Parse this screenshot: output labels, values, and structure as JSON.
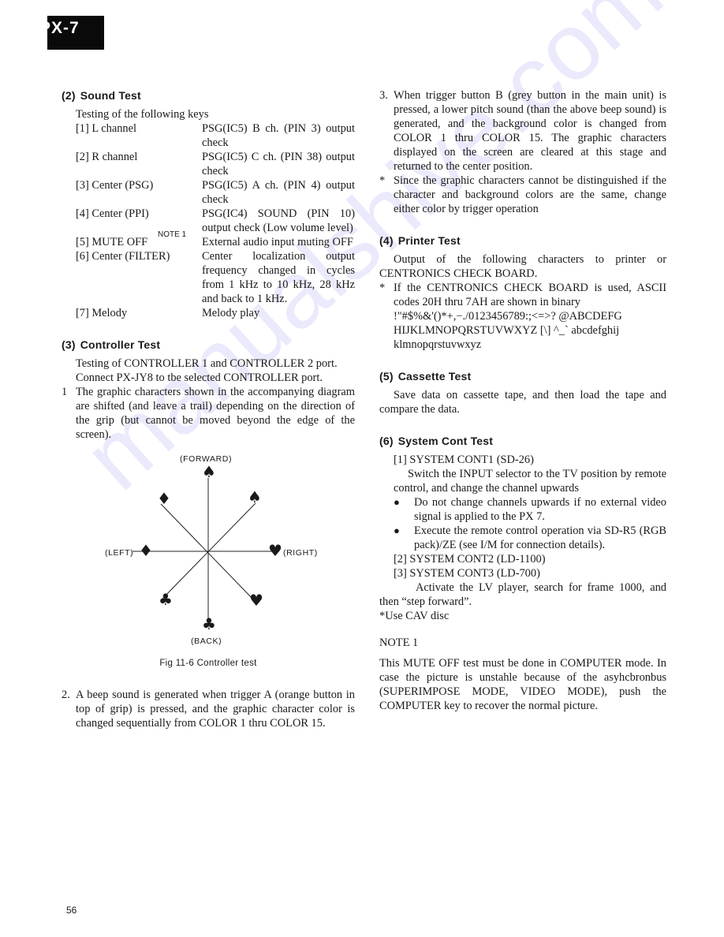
{
  "header": {
    "model_tab": "PX-7"
  },
  "watermark": "manualshive.com",
  "page_number": "56",
  "sound_test": {
    "number": "(2)",
    "title": "Sound Test",
    "intro": "Testing of the following keys",
    "keys": [
      {
        "name": "[1] L channel",
        "desc": "PSG(IC5) B ch. (PIN 3) output check"
      },
      {
        "name": "[2] R channel",
        "desc": "PSG(IC5) C ch. (PIN 38) output check"
      },
      {
        "name": "[3] Center (PSG)",
        "desc": "PSG(IC5) A ch. (PIN 4) output check"
      },
      {
        "name": "[4] Center (PPI)",
        "desc": "PSG(IC4) SOUND (PIN 10) output check (Low volume level)"
      },
      {
        "name": "[5] MUTE OFF",
        "note": "NOTE 1",
        "desc": "External audio input muting OFF"
      },
      {
        "name": "[6] Center (FILTER)",
        "desc": "Center localization output frequency changed in cycles from 1 kHz to 10 kHz, 28 kHz and back to 1 kHz."
      },
      {
        "name": "[7] Melody",
        "desc": "Melody play"
      }
    ]
  },
  "controller_test": {
    "number": "(3)",
    "title": "Controller Test",
    "para1": "Testing of CONTROLLER 1 and CONTROLLER 2 port.",
    "para2": "Connect PX-JY8 to tbe selected CONTROLLER port.",
    "items": [
      {
        "marker": "1",
        "text": "The graphic characters shown in the accompanying diagram are shifted (and leave a trail) depending on the direction of the grip (but cannot be moved beyond the edge of the screen)."
      },
      {
        "marker": "2.",
        "text": "A beep sound is generated when trigger A (orange button in top of grip) is pressed, and the graphic character color is changed sequentially from COLOR 1 thru COLOR 15."
      },
      {
        "marker": "3.",
        "text": "When trigger button B (grey button in the main unit) is pressed, a lower pitch sound (than the above beep sound) is generated, and the background color is changed from COLOR 1 thru COLOR 15. The graphic characters displayed on the screen are cleared at this stage and returned to the center position."
      },
      {
        "marker": "*",
        "text": "Since the graphic characters cannot be distinguished if the character and background colors are the same, change either color by trigger operation"
      }
    ],
    "figure": {
      "labels": {
        "forward": "(FORWARD)",
        "back": "(BACK)",
        "left": "(LEFT)",
        "right": "(RIGHT)"
      },
      "symbols": {
        "up": "♠",
        "up_right": "♠",
        "right": "♥",
        "down_right": "♥",
        "down": "♣",
        "down_left": "♣",
        "left": "♦",
        "up_left": "♦"
      },
      "caption": "Fig 11-6  Controller test"
    }
  },
  "printer_test": {
    "number": "(4)",
    "title": "Printer Test",
    "para": "Output of the following characters to printer or CENTRONICS CHECK BOARD.",
    "note_marker": "*",
    "note": "If the CENTRONICS CHECK BOARD is used, ASCII codes 20H thru 7AH are shown in binary",
    "ascii_lines": [
      "!\"#$%&'()*+,−./0123456789:;<=>? @ABCDEFG",
      "HIJKLMNOPQRSTUVWXYZ [\\] ^_` abcdefghij",
      "klmnopqrstuvwxyz"
    ]
  },
  "cassette_test": {
    "number": "(5)",
    "title": "Cassette Test",
    "para": "Save data on cassette tape, and then load the tape and compare the data."
  },
  "system_cont_test": {
    "number": "(6)",
    "title": "System Cont Test",
    "item1_title": "[1] SYSTEM CONT1 (SD-26)",
    "item1_para": "Switch the INPUT selector to the TV position by remote control, and change the channel upwards",
    "bullets": [
      "Do not change channels upwards if no external video signal is applied to the PX 7.",
      "Execute the remote control operation via SD-R5 (RGB pack)/ZE (see I/M for connection details)."
    ],
    "item2_title": "[2] SYSTEM CONT2 (LD-1100)",
    "item3_title": "[3] SYSTEM CONT3 (LD-700)",
    "item3_para": "Activate the LV player, search for frame 1000, and then “step forward”.",
    "item3_note": "*Use CAV disc"
  },
  "note1": {
    "title": "NOTE 1",
    "text": "This MUTE OFF test must be done in COMPUTER mode. In case the picture is unstahle because of the asyhcbronbus (SUPERIMPOSE MODE, VIDEO MODE), push the COMPUTER key to recover the normal picture."
  }
}
